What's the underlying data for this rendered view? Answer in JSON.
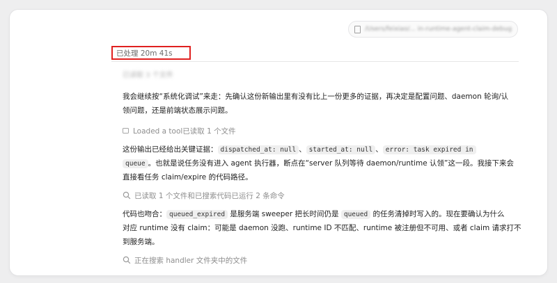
{
  "header": {
    "path_pill_text": "/Users/feixiao/... in-runtime-agent-claim-debug",
    "doc_icon": "document-icon"
  },
  "status": {
    "processed_label": "已处理 20m 41s"
  },
  "blurred_line": "已读取 3 个文件",
  "messages": [
    {
      "lines": [
        [
          "我会继续按“系统化调试”来走：先确认这份新输出里有没有比上一份更多的证据，再决定是配置问题、daemon 轮询/认"
        ],
        [
          "领问题，还是前端状态展示问题。"
        ]
      ]
    },
    {
      "lines": [
        [
          "这份输出已经给出关键证据：",
          {
            "code": "dispatched_at: null"
          },
          "、",
          {
            "code": "started_at: null"
          },
          "、",
          {
            "code": "error: task expired in"
          }
        ],
        [
          {
            "code": "queue"
          },
          "。也就是说任务没有进入 agent 执行器，断点在“server 队列等待 daemon/runtime 认领”这一段。我接下来会"
        ],
        [
          "直接看任务 claim/expire 的代码路径。"
        ]
      ]
    },
    {
      "lines": [
        [
          "代码也吻合：",
          {
            "code": "queued_expired"
          },
          " 是服务端 sweeper 把长时间仍是 ",
          {
            "code": "queued"
          },
          " 的任务清掉时写入的。现在要确认为什么"
        ],
        [
          "对应 runtime 没有 claim：可能是 daemon 没跑、runtime ID 不匹配、runtime 被注册但不可用、或者 claim 请求打不"
        ],
        [
          "到服务端。"
        ]
      ]
    }
  ],
  "activities": [
    {
      "icon": "image-icon",
      "text": "Loaded a tool已读取 1 个文件"
    },
    {
      "icon": "search-icon",
      "text": "已读取 1 个文件和已搜索代码已运行 2 条命令"
    },
    {
      "icon": "search-icon",
      "text": "正在搜索 handler 文件夹中的文件"
    }
  ]
}
